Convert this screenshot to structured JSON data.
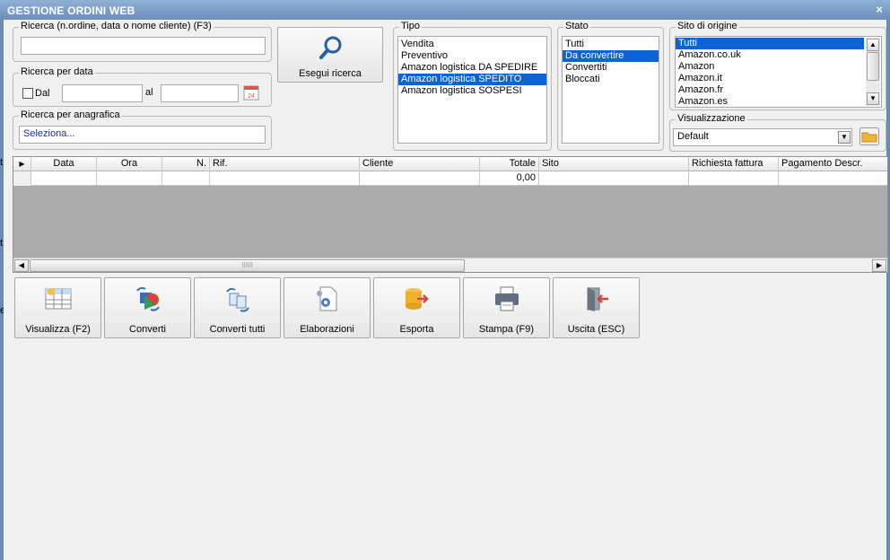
{
  "window": {
    "title": "GESTIONE ORDINI WEB",
    "close_glyph": "×"
  },
  "search": {
    "legend": "Ricerca (n.ordine, data o nome cliente) (F3)",
    "value": "",
    "button_label": "Esegui ricerca",
    "button_icon": "search-icon"
  },
  "date_search": {
    "legend": "Ricerca per data",
    "from_label": "Dal",
    "to_label": "al",
    "from_checked": false,
    "from_value": "",
    "to_value": "",
    "calendar_icon": "calendar-icon",
    "calendar_day": "24"
  },
  "registry_search": {
    "legend": "Ricerca per anagrafica",
    "value": "Seleziona..."
  },
  "tipo": {
    "legend": "Tipo",
    "items": [
      "Vendita",
      "Preventivo",
      "Amazon logistica DA SPEDIRE",
      "Amazon logistica SPEDITO",
      "Amazon logistica SOSPESI"
    ],
    "selected": "Amazon logistica SPEDITO"
  },
  "stato": {
    "legend": "Stato",
    "items": [
      "Tutti",
      "Da convertire",
      "Convertiti",
      "Bloccati"
    ],
    "selected": "Da convertire"
  },
  "sito": {
    "legend": "Sito di origine",
    "items": [
      "Tutti",
      "Amazon.co.uk",
      "Amazon",
      "Amazon.it",
      "Amazon.fr",
      "Amazon.es"
    ],
    "selected": "Tutti"
  },
  "visualizzazione": {
    "legend": "Visualizzazione",
    "value": "Default",
    "folder_icon": "folder-icon"
  },
  "grid": {
    "columns": [
      "Data",
      "Ora",
      "N.",
      "Rif.",
      "Cliente",
      "Totale",
      "Sito",
      "Richiesta fattura",
      "Pagamento Descr."
    ],
    "row": {
      "totale": "0,00"
    }
  },
  "actions": [
    {
      "label": "Visualizza (F2)",
      "icon": "table-view-icon"
    },
    {
      "label": "Converti",
      "icon": "convert-icon"
    },
    {
      "label": "Converti tutti",
      "icon": "convert-all-icon"
    },
    {
      "label": "Elaborazioni",
      "icon": "document-gear-icon"
    },
    {
      "label": "Esporta",
      "icon": "database-export-icon"
    },
    {
      "label": "Stampa (F9)",
      "icon": "printer-icon"
    },
    {
      "label": "Uscita (ESC)",
      "icon": "exit-door-icon"
    }
  ],
  "colors": {
    "selection": "#0a64d6",
    "titlebar": "#7a9cc6",
    "grid_empty": "#ababab"
  },
  "left_edge_marks": [
    "t",
    "t",
    "e"
  ]
}
